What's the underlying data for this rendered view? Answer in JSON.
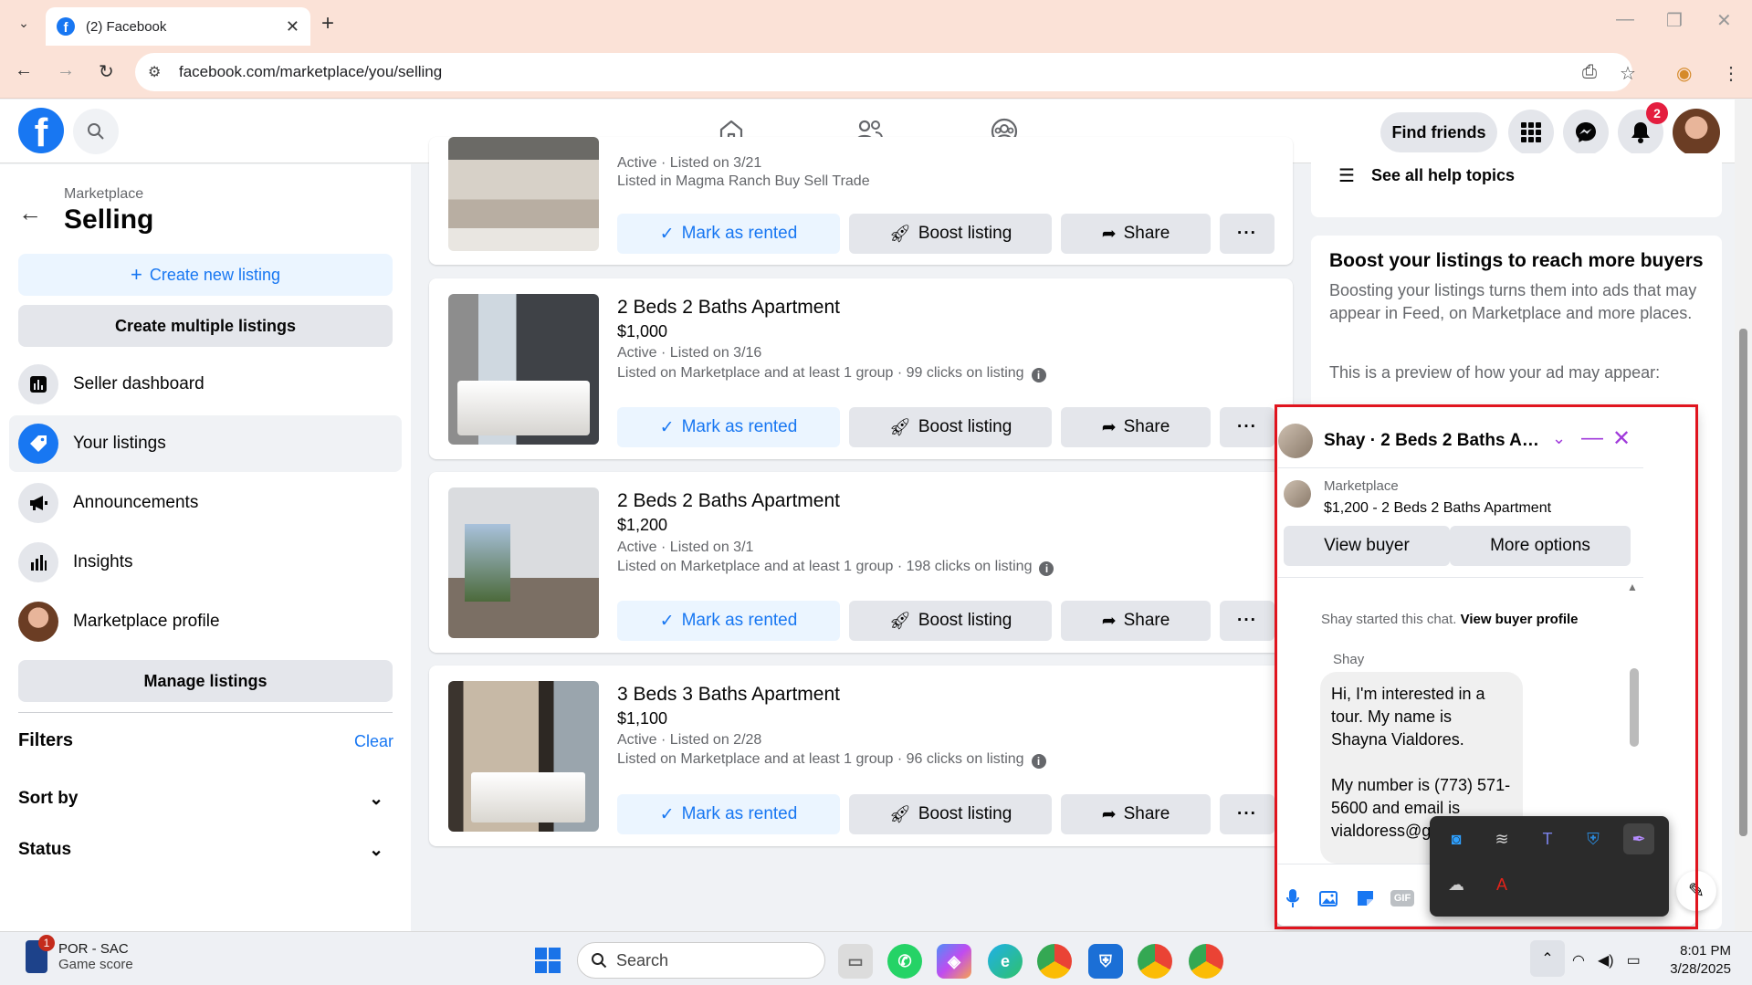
{
  "browser": {
    "tab_title": "(2) Facebook",
    "url": "facebook.com/marketplace/you/selling",
    "new_tab": "+",
    "close_tab": "✕"
  },
  "header": {
    "find_friends": "Find friends",
    "notification_count": "2"
  },
  "sidebar": {
    "breadcrumb": "Marketplace",
    "title": "Selling",
    "create_new": "Create new listing",
    "create_multiple": "Create multiple listings",
    "items": [
      {
        "label": "Seller dashboard",
        "icon": "bar-chart-icon"
      },
      {
        "label": "Your listings",
        "icon": "tag-icon"
      },
      {
        "label": "Announcements",
        "icon": "megaphone-icon"
      },
      {
        "label": "Insights",
        "icon": "insights-icon"
      },
      {
        "label": "Marketplace profile",
        "icon": "profile-avatar"
      }
    ],
    "manage": "Manage listings",
    "filters": "Filters",
    "clear": "Clear",
    "sort_by": "Sort by",
    "status": "Status"
  },
  "listings": [
    {
      "title": "",
      "price": "",
      "status": "Active · Listed on 3/21",
      "meta": "Listed in Magma Ranch Buy Sell Trade"
    },
    {
      "title": "2 Beds 2 Baths Apartment",
      "price": "$1,000",
      "status": "Active · Listed on 3/16",
      "meta": "Listed on Marketplace and at least 1 group · 99 clicks on listing"
    },
    {
      "title": "2 Beds 2 Baths Apartment",
      "price": "$1,200",
      "status": "Active · Listed on 3/1",
      "meta": "Listed on Marketplace and at least 1 group · 198 clicks on listing"
    },
    {
      "title": "3 Beds 3 Baths Apartment",
      "price": "$1,100",
      "status": "Active · Listed on 2/28",
      "meta": "Listed on Marketplace and at least 1 group · 96 clicks on listing"
    }
  ],
  "actions": {
    "mark_rented": "Mark as rented",
    "boost": "Boost listing",
    "share": "Share",
    "more": "···"
  },
  "right_panel": {
    "help_topics": "See all help topics",
    "boost_title": "Boost your listings to reach more buyers",
    "boost_desc": "Boosting your listings turns them into ads that may appear in Feed, on Marketplace and more places.",
    "preview": "This is a preview of how your ad may appear:"
  },
  "chat": {
    "title": "Shay · 2 Beds 2 Baths Apar…",
    "mp_label": "Marketplace",
    "mp_title": "$1,200 - 2 Beds 2 Baths Apartment",
    "view_buyer": "View buyer",
    "more_options": "More options",
    "started": "Shay started this chat.",
    "view_profile": "View buyer profile",
    "sender": "Shay",
    "message": "Hi, I'm interested in a tour. My name is Shayna Vialdores.\n\nMy number is (773) 571-5600 and email is vialdoress@g"
  },
  "taskbar": {
    "game_line1": "POR - SAC",
    "game_line2": "Game score",
    "game_badge": "1",
    "search": "Search",
    "time": "8:01 PM",
    "date": "3/28/2025"
  },
  "colors": {
    "fb_blue": "#1877f2",
    "tab_bg": "#fbe2d7",
    "highlight_red": "#e0141e",
    "messenger_purple": "#a03adb"
  }
}
